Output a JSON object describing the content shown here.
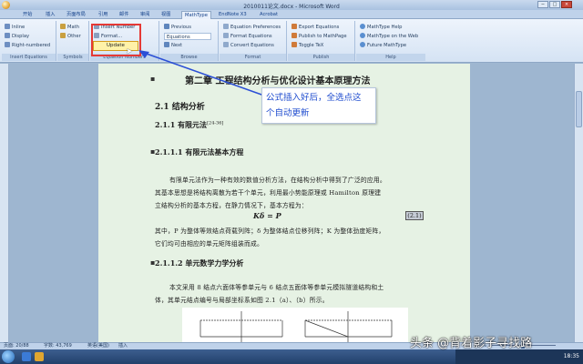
{
  "window": {
    "title": "2010011论文.docx - Microsoft Word",
    "minimize": "−",
    "maximize": "□",
    "close": "×"
  },
  "tabs": [
    "开始",
    "插入",
    "页面布局",
    "引用",
    "邮件",
    "审阅",
    "视图",
    "MathType",
    "EndNote X3",
    "Acrobat"
  ],
  "ribbon": {
    "insert_equations": {
      "caption": "Insert Equations",
      "inline": "Inline",
      "display": "Display",
      "right_numbered": "Right-numbered"
    },
    "symbols": {
      "caption": "Symbols",
      "math": "Math",
      "other": "Other"
    },
    "equation_numbers": {
      "caption": "Equation Numbers",
      "insert_number": "Insert Number",
      "format": "Format...",
      "update": "Update"
    },
    "browse": {
      "caption": "Browse",
      "previous": "Previous",
      "equations": "Equations",
      "next": "Next"
    },
    "format": {
      "caption": "Format",
      "equation_preferences": "Equation Preferences",
      "format_equations": "Format Equations",
      "convert_equations": "Convert Equations"
    },
    "publish": {
      "caption": "Publish",
      "export_equations": "Export Equations",
      "publish_to_mathpage": "Publish to MathPage",
      "toggle_tex": "Toggle TeX"
    },
    "help": {
      "caption": "Help",
      "mathtype_help": "MathType Help",
      "mathtype_web": "MathType on the Web",
      "future_mathtype": "Future MathType"
    }
  },
  "document": {
    "chapter_title": "第二章   工程结构分析与优化设计基本原理方法",
    "s21": "2.1  结构分析",
    "s211": "2.1.1  有限元法",
    "s211_cite": "[24-36]",
    "s2111": "2.1.1.1  有限元法基本方程",
    "para1_line1": "有限单元法作为一种有效的数值分析方法，在结构分析中得到了广泛的应用。",
    "para1_line2": "其基本思想是将结构离散为若干个单元，利用最小势能原理或 Hamilton 原理建",
    "para1_line3": "立结构分析的基本方程，在静力情况下，基本方程为：",
    "equation": "Kδ = P",
    "equation_number": "(2.1)",
    "para2_line1": "其中，P 为整体等效结点荷载列阵；δ 为整体结点位移列阵；K 为整体劲度矩阵，",
    "para2_line2": "它们均可由相应的单元矩阵组装而成。",
    "s2112": "2.1.1.2  单元数学力学分析",
    "para3_line1": "本文采用 8 结点六面体等参单元与 6 结点五面体等参单元模拟隧道结构和土",
    "para3_line2": "体，其单元结点编号与局部坐标系如图 2.1（a）、（b）所示。"
  },
  "callout": {
    "line1": "公式插入好后，全选点这",
    "line2": "个自动更新"
  },
  "statusbar": {
    "page": "页面: 20/88",
    "words": "字数: 43,769",
    "language": "英语(美国)",
    "mode": "插入",
    "zoom": "100%"
  },
  "taskbar": {
    "clock": "18:35"
  },
  "watermark": "头条 @背着影子寻找路",
  "colors": {
    "page_bg": "#e6f2e4",
    "callout_text": "#1f4ccf",
    "highlight": "#e53935",
    "popup_bg": "#fff2a8"
  }
}
